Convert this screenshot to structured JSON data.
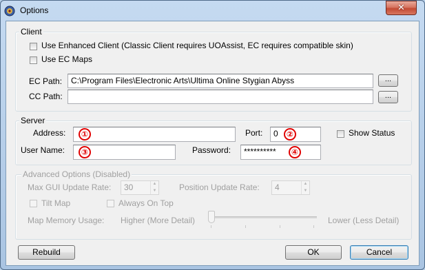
{
  "window": {
    "title": "Options",
    "close_glyph": "✕",
    "icon": "uo-app-icon"
  },
  "client": {
    "group_label": "Client",
    "enhanced_checkbox_label": "Use Enhanced Client (Classic Client requires UOAssist, EC requires compatible skin)",
    "enhanced_checked": false,
    "ec_maps_label": "Use EC Maps",
    "ec_maps_checked": false,
    "ec_path_label": "EC Path:",
    "ec_path_value": "C:\\Program Files\\Electronic Arts\\Ultima Online Stygian Abyss",
    "ec_browse_label": "...",
    "cc_path_label": "CC Path:",
    "cc_path_value": "",
    "cc_browse_label": "..."
  },
  "server": {
    "group_label": "Server",
    "address_label": "Address:",
    "address_value": "",
    "port_label": "Port:",
    "port_value": "0",
    "show_status_label": "Show Status",
    "show_status_checked": false,
    "username_label": "User Name:",
    "username_value": "",
    "password_label": "Password:",
    "password_value": "**********",
    "markers": [
      "①",
      "②",
      "③",
      "④"
    ]
  },
  "advanced": {
    "group_label": "Advanced Options (Disabled)",
    "max_gui_label": "Max GUI Update Rate:",
    "max_gui_value": "30",
    "position_label": "Position Update Rate:",
    "position_value": "4",
    "tilt_map_label": "Tilt Map",
    "always_on_top_label": "Always On Top",
    "memory_label": "Map Memory Usage:",
    "memory_low_label": "Higher (More Detail)",
    "memory_high_label": "Lower (Less Detail)",
    "memory_level": 0
  },
  "footer": {
    "rebuild_label": "Rebuild",
    "ok_label": "OK",
    "cancel_label": "Cancel"
  }
}
